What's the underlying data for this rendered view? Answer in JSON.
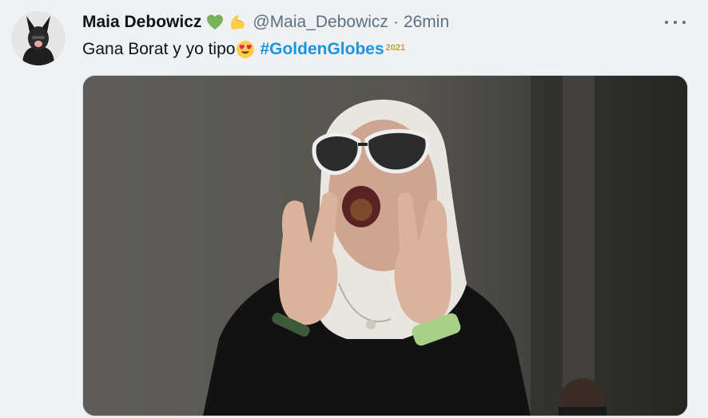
{
  "tweet": {
    "display_name": "Maia Debowicz",
    "name_emojis": [
      "green-heart-icon",
      "flexed-biceps-icon"
    ],
    "handle": "@Maia_Debowicz",
    "separator": "·",
    "time": "26min",
    "text": "Gana Borat y yo tipo",
    "text_emoji": "heart-eyes-emoji-icon",
    "hashtag": "#GoldenGlobes",
    "hashtag_badge": "2021",
    "colors": {
      "background": "#f0f1f2",
      "text": "#0f1419",
      "secondary": "#5b7083",
      "link": "#1b95e0"
    }
  }
}
